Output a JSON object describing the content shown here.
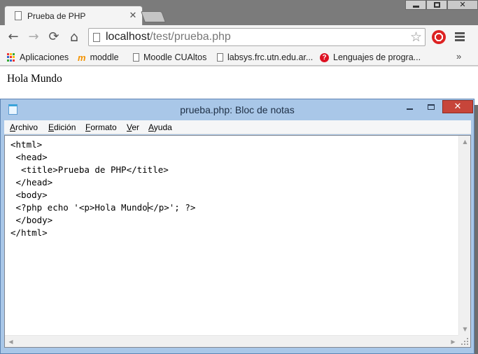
{
  "browser": {
    "tab": {
      "title": "Prueba de PHP",
      "close_glyph": "✕"
    },
    "nav": {
      "back": "←",
      "forward": "→",
      "reload": "⟳",
      "home": "⌂"
    },
    "address": {
      "host": "localhost",
      "path": "/test/prueba.php"
    },
    "bookmarks": [
      {
        "label": "Aplicaciones",
        "icon": "apps-grid-icon"
      },
      {
        "label": "moddle",
        "icon": "moodle-icon"
      },
      {
        "label": "Moodle CUAltos",
        "icon": "document-icon"
      },
      {
        "label": "labsys.frc.utn.edu.ar...",
        "icon": "document-icon"
      },
      {
        "label": "Lenguajes de progra...",
        "icon": "question-icon"
      }
    ],
    "bookmarks_more": "»",
    "page": {
      "text": "Hola Mundo"
    }
  },
  "notepad": {
    "title": "prueba.php: Bloc de notas",
    "menus": [
      {
        "accel": "A",
        "rest": "rchivo"
      },
      {
        "accel": "E",
        "rest": "dición"
      },
      {
        "accel": "F",
        "rest": "ormato"
      },
      {
        "accel": "V",
        "rest": "er"
      },
      {
        "accel": "A",
        "rest": "yuda"
      }
    ],
    "content": {
      "line1": "<html>",
      "line2": " <head>",
      "line3": "  <title>Prueba de PHP</title>",
      "line4": " </head>",
      "line5": " <body>",
      "line6_before": " <?php echo '<p>Hola Mundo",
      "line6_after": "</p>'; ?>",
      "line7": " </body>",
      "line8": "</html>"
    }
  }
}
